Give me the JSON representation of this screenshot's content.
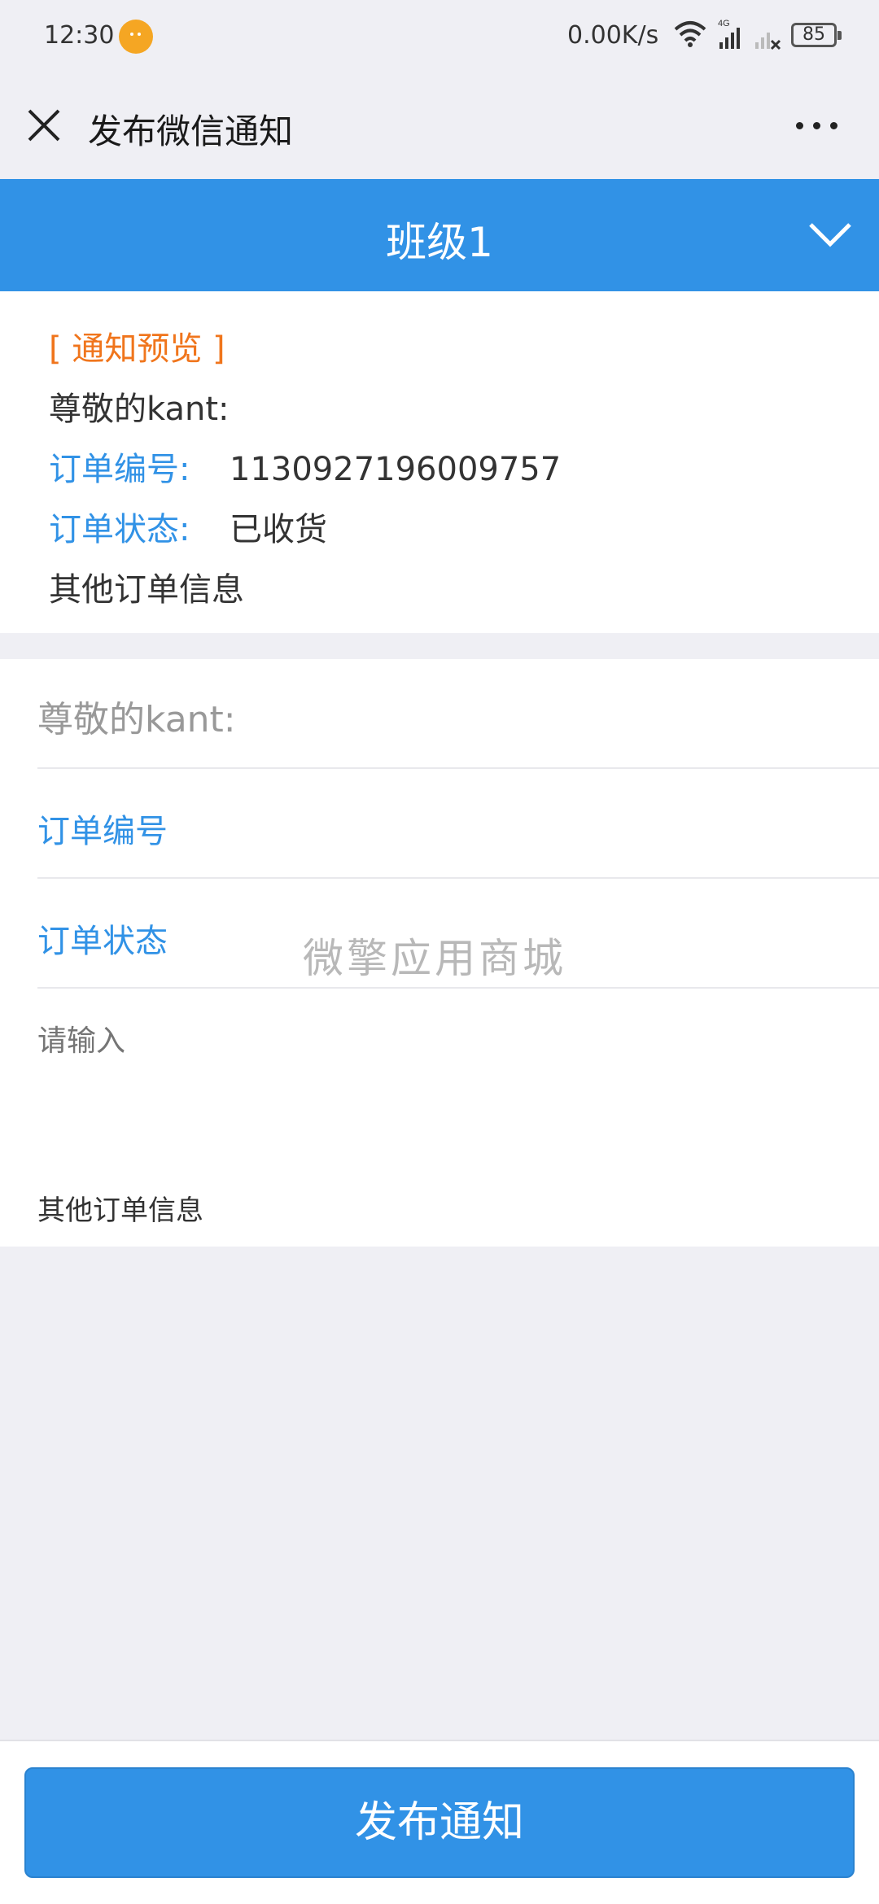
{
  "status_bar": {
    "time": "12:30",
    "net_speed": "0.00K/s",
    "battery": "85",
    "signal_label": "4G"
  },
  "header": {
    "title": "发布微信通知"
  },
  "class_selector": {
    "label": "班级1"
  },
  "preview": {
    "tag": "[ 通知预览 ]",
    "greeting": "尊敬的kant:",
    "order_no_label": "订单编号:",
    "order_no_value": "1130927196009757",
    "order_status_label": "订单状态:",
    "order_status_value": "已收货",
    "footer": "其他订单信息"
  },
  "form": {
    "greeting": "尊敬的kant:",
    "order_no_label": "订单编号",
    "order_status_label": "订单状态",
    "watermark": "微擎应用商城",
    "textarea_placeholder": "请输入",
    "note": "其他订单信息"
  },
  "actions": {
    "publish_label": "发布通知"
  },
  "colors": {
    "primary": "#3192e6",
    "accent_orange": "#f0751c",
    "background": "#efeff4"
  }
}
